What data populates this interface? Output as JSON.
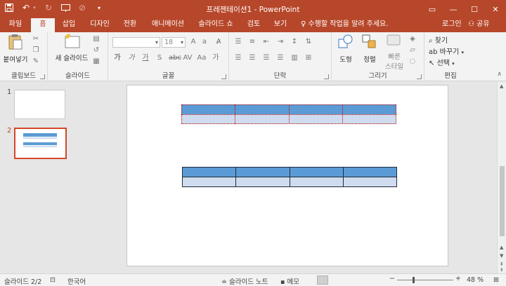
{
  "window": {
    "title": "프레젠테이션1 - PowerPoint",
    "controls": [
      "ribbon-display-icon",
      "minimize-icon",
      "maximize-icon",
      "close-icon"
    ]
  },
  "quick_access": [
    "save-icon",
    "undo-icon",
    "redo-icon",
    "start-from-beginning-icon",
    "touch-mode-icon",
    "customize-icon"
  ],
  "tabs": [
    {
      "label": "파일"
    },
    {
      "label": "홈",
      "active": true
    },
    {
      "label": "삽입"
    },
    {
      "label": "디자인"
    },
    {
      "label": "전환"
    },
    {
      "label": "애니메이션"
    },
    {
      "label": "슬라이드 쇼"
    },
    {
      "label": "검토"
    },
    {
      "label": "보기"
    }
  ],
  "tell_me": "수행할 작업을 알려 주세요.",
  "login": "로그인",
  "share": "공유",
  "ribbon": {
    "clipboard": {
      "label": "클립보드",
      "paste": "붙여넣기"
    },
    "slides": {
      "label": "슬라이드",
      "new_slide": "새 슬라이드"
    },
    "font": {
      "label": "글꼴",
      "font_name": "",
      "font_size": "18"
    },
    "paragraph": {
      "label": "단락"
    },
    "drawing": {
      "label": "그리기",
      "shapes": "도형",
      "arrange": "정렬",
      "quick_styles_1": "빠른",
      "quick_styles_2": "스타일"
    },
    "editing": {
      "label": "편집",
      "find": "찾기",
      "replace": "바꾸기",
      "select": "선택"
    }
  },
  "slides": [
    {
      "number": "1",
      "selected": false
    },
    {
      "number": "2",
      "selected": true
    }
  ],
  "status": {
    "slide_info": "슬라이드 2/2",
    "language": "한국어",
    "notes": "슬라이드 노트",
    "comments": "메모",
    "zoom": "48 %"
  },
  "colors": {
    "accent": "#b7472a",
    "table_header": "#5b9bd5",
    "table_body": "#cfdcef",
    "selection_border": "#c00000"
  }
}
